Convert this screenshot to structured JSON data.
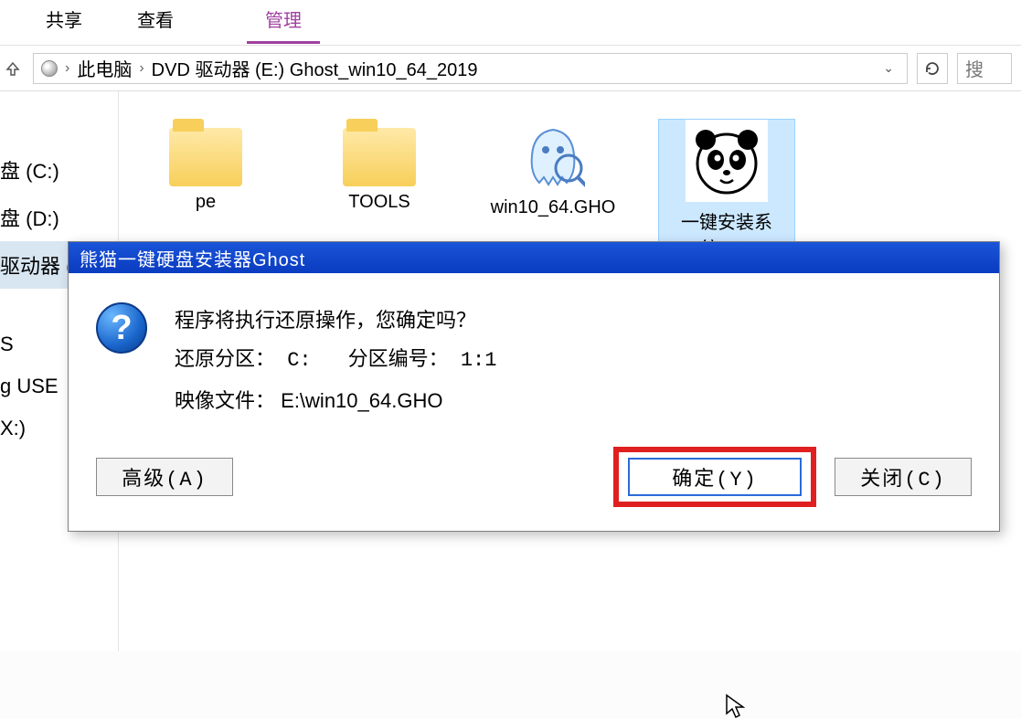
{
  "ribbon": {
    "share": "共享",
    "view": "查看",
    "manage": "管理"
  },
  "breadcrumb": {
    "this_pc": "此电脑",
    "drive": "DVD 驱动器 (E:) Ghost_win10_64_2019"
  },
  "search_hint": "搜",
  "sidebar": {
    "c": "盘 (C:)",
    "d": "盘 (D:)",
    "e": "驱动器 (E:) G",
    "s": "S",
    "usb": "g USE",
    "x": "X:)"
  },
  "files": {
    "pe": "pe",
    "tools": "TOOLS",
    "gho": "win10_64.GHO",
    "exe": "一键安装系统.exe"
  },
  "dialog": {
    "title": "熊猫一键硬盘安装器Ghost",
    "line1": "程序将执行还原操作，您确定吗？",
    "partition_label": "还原分区：",
    "partition_value": "C:",
    "partno_label": "分区编号：",
    "partno_value": "1:1",
    "image_label": "映像文件：",
    "image_value": "E:\\win10_64.GHO",
    "advanced": "高级(A)",
    "ok": "确定(Y)",
    "close": "关闭(C)"
  }
}
